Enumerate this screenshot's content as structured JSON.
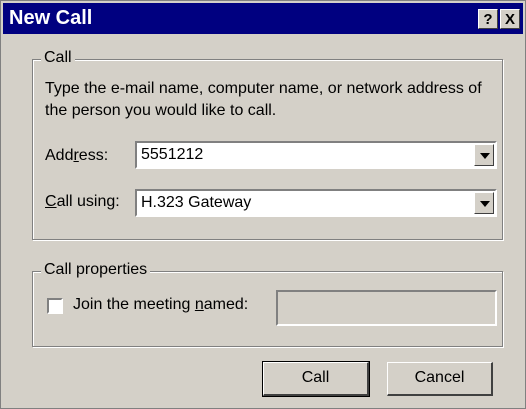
{
  "window": {
    "title": "New Call",
    "help_button": "?",
    "close_button": "X"
  },
  "call_group": {
    "legend": "Call",
    "instructions": "Type the e-mail name, computer name, or network address of the person you would like to call.",
    "address_label_pre": "Add",
    "address_label_u": "r",
    "address_label_post": "ess:",
    "address_value": "5551212",
    "callusing_label_u": "C",
    "callusing_label_post": "all using:",
    "callusing_value": "H.323 Gateway"
  },
  "properties_group": {
    "legend": "Call properties",
    "join_label_pre": "Join the meeting ",
    "join_label_u": "n",
    "join_label_post": "amed:",
    "join_checked": false,
    "meeting_name_value": ""
  },
  "buttons": {
    "call": "Call",
    "cancel": "Cancel"
  }
}
